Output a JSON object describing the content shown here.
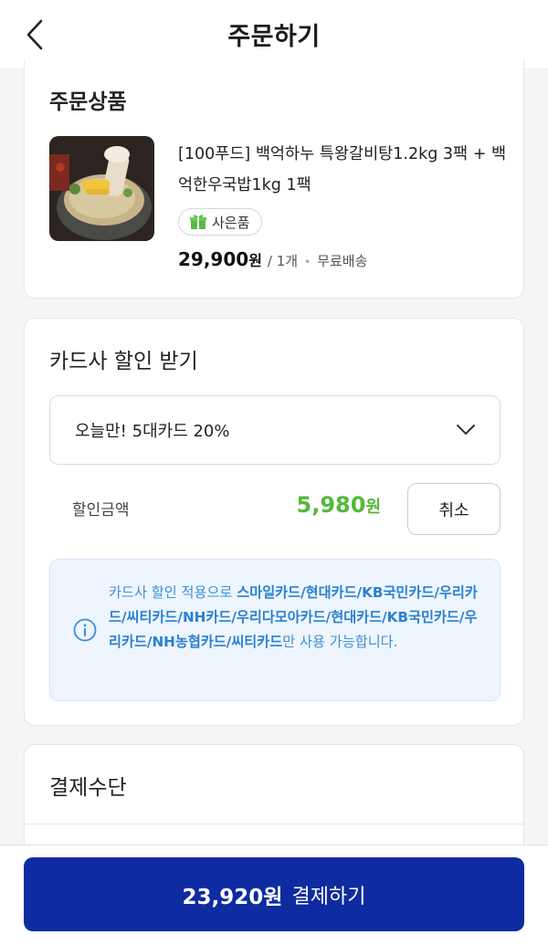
{
  "header": {
    "title": "주문하기",
    "back_icon": "chevron-left-icon"
  },
  "order": {
    "section_title": "주문상품",
    "product_name": "[100푸드] 백억하누 특왕갈비탕1.2kg 3팩 + 백억한우국밥1kg 1팩",
    "gift_badge": "사은품",
    "price": "29,900",
    "price_unit": "원",
    "quantity": "/ 1개",
    "shipping": "무료배송"
  },
  "discount": {
    "section_title": "카드사 할인 받기",
    "selected_option": "오늘만! 5대카드 20%",
    "amount_label": "할인금액",
    "amount": "5,980",
    "amount_unit": "원",
    "cancel_label": "취소",
    "info_prefix": "카드사 할인 적용으로 ",
    "info_cards": "스마일카드/현대카드/KB국민카드/우리카드/씨티카드/NH카드/우리다모아카드/현대카드/KB국민카드/우리카드/NH농협카드/씨티카드",
    "info_suffix": "만 사용 가능합니다."
  },
  "payment": {
    "section_title": "결제수단"
  },
  "footer": {
    "pay_amount": "23,920원",
    "pay_label": "결제하기"
  },
  "colors": {
    "accent": "#0e2ba1",
    "discount_green": "#55b83a",
    "info_blue": "#3d8fd6",
    "info_bg": "#eef5fd"
  }
}
